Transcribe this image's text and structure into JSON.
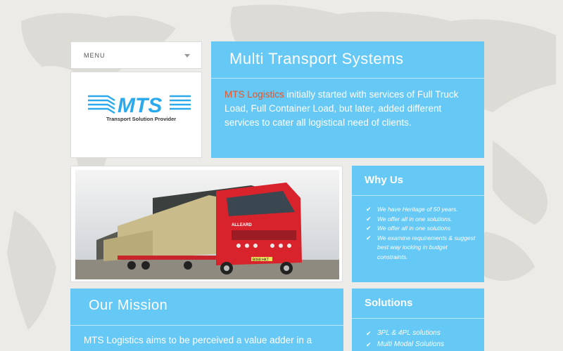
{
  "menu": {
    "label": "MENU"
  },
  "logo": {
    "wordmark": "MTS",
    "tagline": "Transport Solution Provider"
  },
  "hero": {
    "title": "Multi Transport Systems",
    "brand_name": "MTS Logistics",
    "text": " initially started with services of Full Truck Load, Full Container Load, but later, added different services to cater all logistical need of clients."
  },
  "photo": {
    "plate": "B068 HKT",
    "cab_text": "ALLEARD"
  },
  "why_us": {
    "title": "Why Us",
    "items": [
      "We have Heritage of 50 years.",
      "We offer all in one solutions.",
      "We offer all in one solutions",
      "We examine requirements & suggest best way locking in budget constraints."
    ]
  },
  "mission": {
    "title": "Our Mission",
    "text": "MTS Logistics aims to be perceived a value adder in a"
  },
  "solutions": {
    "title": "Solutions",
    "items": [
      "3PL & 4PL solutions",
      "Multi Modal Solutions"
    ]
  },
  "colors": {
    "panel_blue": "#66c8f5",
    "brand_orange": "#e2562a",
    "logo_blue": "#2aa9ec"
  },
  "icons": {
    "menu_toggle": "chevron-down-icon",
    "list_bullet": "check-icon"
  }
}
